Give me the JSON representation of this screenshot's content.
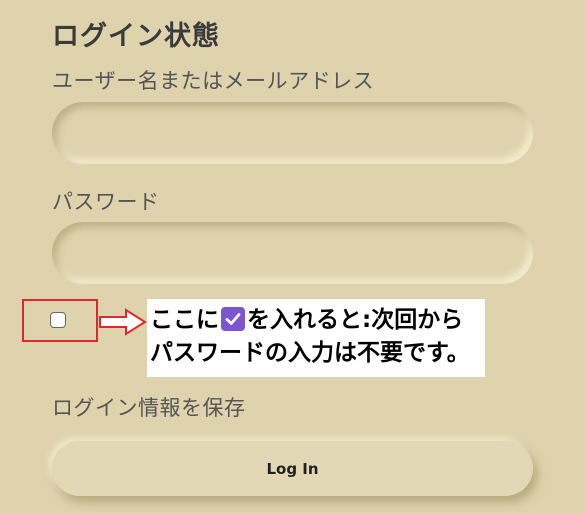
{
  "page": {
    "title": "ログイン状態",
    "username_label": "ユーザー名またはメールアドレス",
    "username_value": "",
    "password_label": "パスワード",
    "password_value": "",
    "remember_label": "ログイン情報を保存",
    "remember_checked": false,
    "login_button": "Log In"
  },
  "annotation": {
    "line1_before": "ここに",
    "line1_after": "を入れると:次回から",
    "line2": "パスワードの入力は不要です。",
    "box_color": "#e0282c",
    "check_color": "#7e55d0"
  },
  "icons": [
    "checkmark-icon",
    "arrow-right-icon"
  ]
}
